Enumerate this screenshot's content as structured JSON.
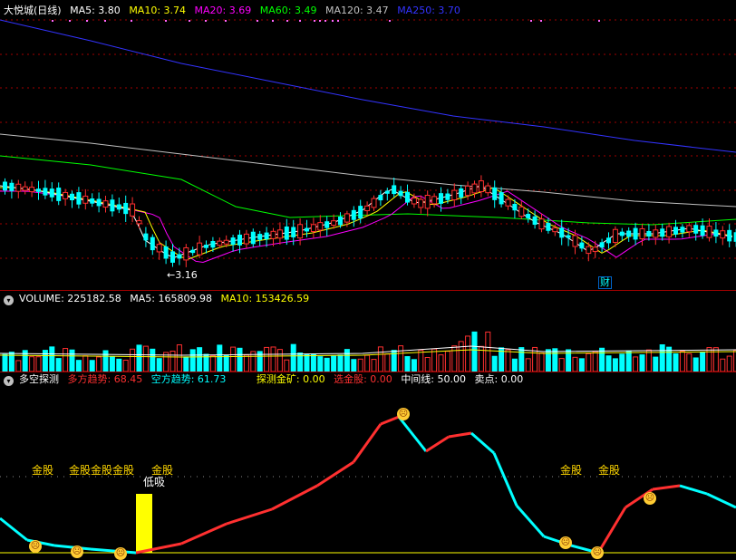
{
  "main": {
    "stock_name": "大悦城(日线)",
    "ma": [
      {
        "label": "MA5: 3.80",
        "color": "#ffffff"
      },
      {
        "label": "MA10: 3.74",
        "color": "#ffff00"
      },
      {
        "label": "MA20: 3.69",
        "color": "#ff00ff"
      },
      {
        "label": "MA60: 3.49",
        "color": "#00ff00"
      },
      {
        "label": "MA120: 3.47",
        "color": "#c0c0c0"
      },
      {
        "label": "MA250: 3.70",
        "color": "#3333ff"
      }
    ],
    "low_label": "←3.16",
    "finance_mark": "财"
  },
  "volume": {
    "header": "VOLUME: 225182.58",
    "ma5": "MA5: 165809.98",
    "ma10": "MA10: 153426.59"
  },
  "indicator": {
    "name": "多空探测",
    "items": [
      {
        "label": "多方趋势: 68.45",
        "color": "#ff3030"
      },
      {
        "label": "空方趋势: 61.73",
        "color": "#00ffff"
      },
      {
        "label": "探测金矿: 0.00",
        "color": "#ffff00"
      },
      {
        "label": "选金股: 0.00",
        "color": "#ff3030"
      },
      {
        "label": "中间线: 50.00",
        "color": "#ffffff"
      },
      {
        "label": "卖点: 0.00",
        "color": "#ffffff"
      }
    ],
    "signals": [
      "金股",
      "金股金股金股",
      "金股",
      "金股",
      "金股"
    ],
    "low_buy": "低吸"
  },
  "colors": {
    "up": "#ff3030",
    "down": "#00ffff",
    "grid": "#a00000"
  },
  "chart_data": {
    "type": "candlestick",
    "series": [
      {
        "name": "MA5",
        "values": [
          3.8
        ]
      },
      {
        "name": "MA10",
        "values": [
          3.74
        ]
      },
      {
        "name": "MA20",
        "values": [
          3.69
        ]
      },
      {
        "name": "MA60",
        "values": [
          3.49
        ]
      },
      {
        "name": "MA120",
        "values": [
          3.47
        ]
      },
      {
        "name": "MA250",
        "values": [
          3.7
        ]
      }
    ],
    "annotations": [
      "←3.16",
      "财"
    ],
    "volume": {
      "value": 225182.58,
      "ma5": 165809.98,
      "ma10": 153426.59
    },
    "indicator": {
      "多方趋势": 68.45,
      "空方趋势": 61.73,
      "探测金矿": 0.0,
      "选金股": 0.0,
      "中间线": 50.0,
      "卖点": 0.0
    }
  }
}
